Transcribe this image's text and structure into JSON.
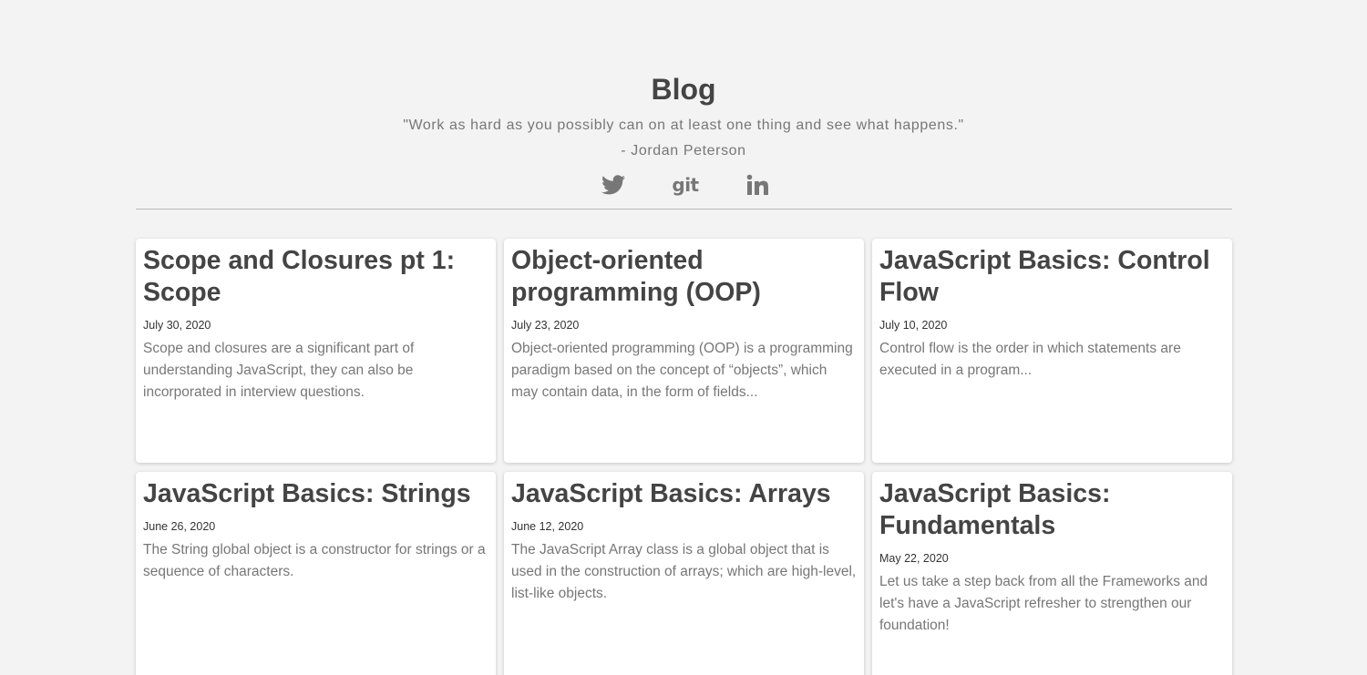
{
  "header": {
    "title": "Blog",
    "quote": "\"Work as hard as you possibly can on at least one thing and see what happens.\"",
    "author": "- Jordan Peterson",
    "social": [
      {
        "icon": "twitter-icon"
      },
      {
        "icon": "git-icon",
        "label": "git"
      },
      {
        "icon": "linkedin-icon"
      }
    ]
  },
  "posts": [
    {
      "title": "Scope and Closures pt 1: Scope",
      "date": "July 30, 2020",
      "excerpt": "Scope and closures are a significant part of understanding JavaScript, they can also be incorporated in interview questions."
    },
    {
      "title": "Object-oriented programming (OOP)",
      "date": "July 23, 2020",
      "excerpt": "Object-oriented programming (OOP) is a programming paradigm based on the concept of “objects”, which may contain data, in the form of fields..."
    },
    {
      "title": "JavaScript Basics: Control Flow",
      "date": "July 10, 2020",
      "excerpt": "Control flow is the order in which statements are executed in a program..."
    },
    {
      "title": "JavaScript Basics: Strings",
      "date": "June 26, 2020",
      "excerpt": "The String global object is a constructor for strings or a sequence of characters."
    },
    {
      "title": "JavaScript Basics: Arrays",
      "date": "June 12, 2020",
      "excerpt": "The JavaScript Array class is a global object that is used in the construction of arrays; which are high-level, list-like objects."
    },
    {
      "title": "JavaScript Basics: Fundamentals",
      "date": "May 22, 2020",
      "excerpt": "Let us take a step back from all the Frameworks and let's have a JavaScript refresher to strengthen our foundation!"
    }
  ]
}
